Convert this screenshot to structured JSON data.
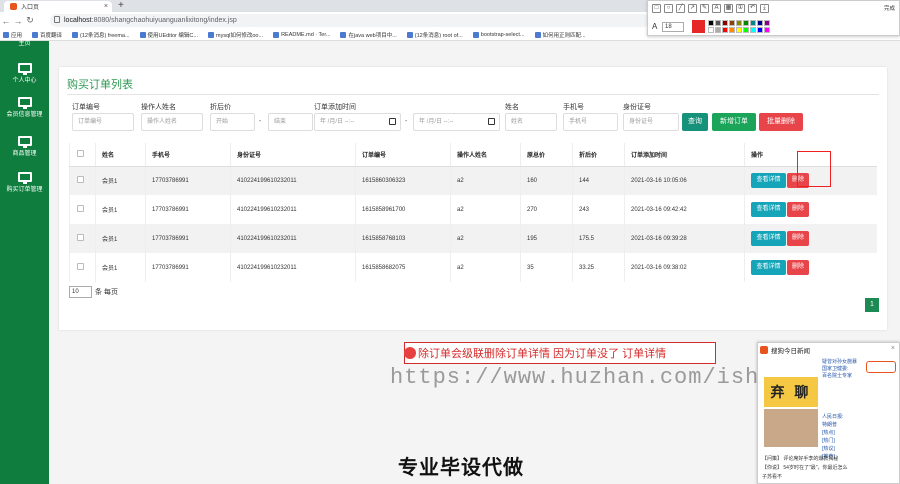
{
  "browser": {
    "tab_title": "入口页",
    "new_tab": "+",
    "url_host": "localhost",
    "url_path": ":8080/shangchaohuiyuanguanlixitong/index.jsp",
    "bookmarks": [
      "应用",
      "百度翻译",
      "(12条消息) freema...",
      "使用UEditor 编辑C...",
      "mysql如何修改oo...",
      "README.md · Ter...",
      "在java web项目中...",
      "(12条消息) root of...",
      "bootstrap-select...",
      "如何用正则匹配..."
    ]
  },
  "annotation_toolbar": {
    "done_label": "完成",
    "font_label": "A",
    "font_size": "18",
    "current_color": "#e52727",
    "palette": [
      "#000000",
      "#555555",
      "#880000",
      "#884400",
      "#888800",
      "#008800",
      "#008888",
      "#000088",
      "#880088",
      "#ffffff",
      "#aaaaaa",
      "#ff0000",
      "#ff8800",
      "#ffff00",
      "#00ff00",
      "#00ffff",
      "#0000ff",
      "#ff00ff"
    ]
  },
  "sidebar": {
    "items": [
      {
        "label": "主页"
      },
      {
        "label": "个人中心"
      },
      {
        "label": "会员信息管理"
      },
      {
        "label": "商品管理"
      },
      {
        "label": "购买订单管理"
      }
    ]
  },
  "page": {
    "title": "购买订单列表",
    "filters": {
      "order_no_label": "订单编号",
      "order_no_placeholder": "订单编号",
      "operator_label": "操作人姓名",
      "operator_placeholder": "操作人姓名",
      "discount_label": "折后价",
      "discount_start_placeholder": "开始",
      "discount_end_placeholder": "结束",
      "added_time_label": "订单添加时间",
      "date_placeholder": "年 /月/日 --:--",
      "name_label": "姓名",
      "name_placeholder": "姓名",
      "phone_label": "手机号",
      "phone_placeholder": "手机号",
      "idcard_label": "身份证号",
      "idcard_placeholder": "身份证号",
      "range_sep": "-"
    },
    "buttons": {
      "search": "查询",
      "add": "新增订单",
      "batch_delete": "批量删除"
    },
    "table": {
      "columns": [
        "",
        "姓名",
        "手机号",
        "身份证号",
        "订单编号",
        "操作人姓名",
        "原总价",
        "折后价",
        "订单添加时间",
        "操作"
      ],
      "rows": [
        {
          "name": "会员1",
          "phone": "17703786991",
          "idcard": "410224199610232011",
          "order_no": "1615860306323",
          "operator": "a2",
          "original": "160",
          "discounted": "144",
          "time": "2021-03-16 10:05:06"
        },
        {
          "name": "会员1",
          "phone": "17703786991",
          "idcard": "410224199610232011",
          "order_no": "1615858961700",
          "operator": "a2",
          "original": "270",
          "discounted": "243",
          "time": "2021-03-16 09:42:42"
        },
        {
          "name": "会员1",
          "phone": "17703786991",
          "idcard": "410224199610232011",
          "order_no": "1615858768103",
          "operator": "a2",
          "original": "195",
          "discounted": "175.5",
          "time": "2021-03-16 09:39:28"
        },
        {
          "name": "会员1",
          "phone": "17703786991",
          "idcard": "410224199610232011",
          "order_no": "1615858682075",
          "operator": "a2",
          "original": "35",
          "discounted": "33.25",
          "time": "2021-03-16 09:38:02"
        }
      ],
      "view_label": "查看详情",
      "delete_label": "删除"
    },
    "pagination": {
      "page_size": "10",
      "per_page_label": "条 每页",
      "current_page": "1"
    }
  },
  "overlays": {
    "note": "除订单会级联删除订单详情 因为订单没了  订单详情",
    "watermark": "https://www.huzhan.com/ishop39397",
    "slogan": "专业毕设代做",
    "news": {
      "title": "搜狗今日新闻",
      "big_image_text": "弃 聊",
      "headlines": [
        "疑曾对孙女施暴",
        "国家卫健委:",
        "百名院士专家",
        "人民日报:",
        "特朗普",
        "[热点]",
        "[热门]",
        "[热议]",
        "[推荐]"
      ],
      "bottom_lines": [
        "【问策】 评论席好手李的爆款揭秘",
        "【你说】 54岁时在了\"最\"，你最近怎么",
        "子苏看不"
      ]
    }
  }
}
